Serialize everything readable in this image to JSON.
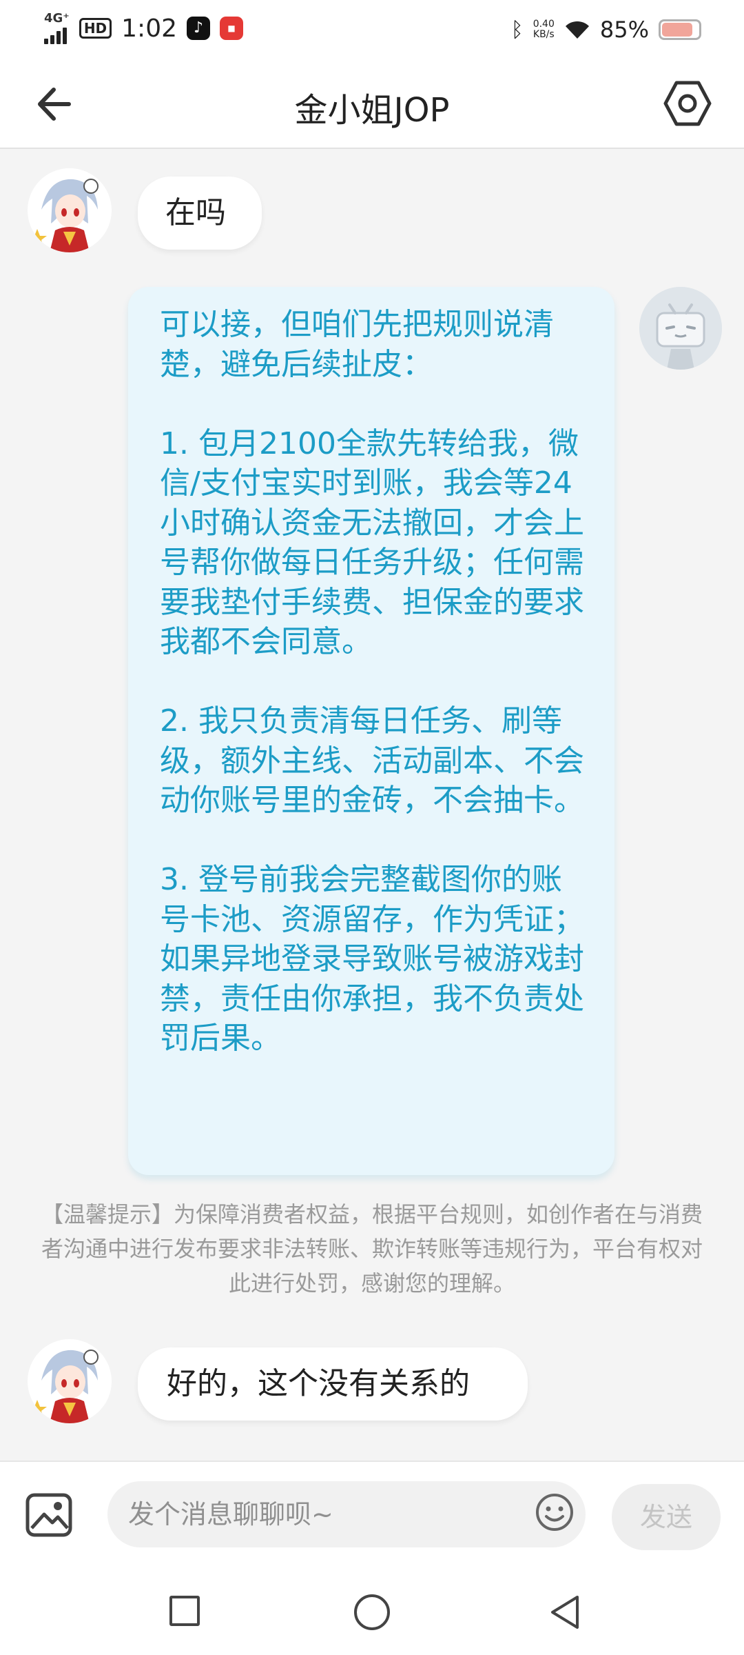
{
  "status_bar": {
    "network": "4G⁺",
    "time": "1:02",
    "hd": "HD",
    "net_speed_value": "0.40",
    "net_speed_unit": "KB/s",
    "battery_pct": "85%",
    "battery_level": 0.85,
    "battery_color": "#f1a59a"
  },
  "header": {
    "title": "金小姐JOP",
    "back_icon": "arrow-left-icon",
    "settings_icon": "hexagon-settings-icon"
  },
  "messages": {
    "m1": {
      "side": "left",
      "text": "在吗"
    },
    "m2": {
      "side": "right",
      "paragraphs": [
        "可以接，但咱们先把规则说清楚，避免后续扯皮：",
        "1. 包月2100全款先转给我，微信/支付宝实时到账，我会等24小时确认资金无法撤回，才会上号帮你做每日任务升级；任何需要我垫付手续费、担保金的要求我都不会同意。",
        "2. 我只负责清每日任务、刷等级，额外主线、活动副本、不会动你账号里的金砖，不会抽卡。",
        "3. 登号前我会完整截图你的账号卡池、资源留存，作为凭证；如果异地登录导致账号被游戏封禁，责任由你承担，我不负责处罚后果。"
      ]
    },
    "notice": "【温馨提示】为保障消费者权益，根据平台规则，如创作者在与消费者沟通中进行发布要求非法转账、欺诈转账等违规行为，平台有权对此进行处罚，感谢您的理解。",
    "m3": {
      "side": "left",
      "text": "好的，这个没有关系的"
    }
  },
  "input_bar": {
    "placeholder": "发个消息聊聊呗~",
    "send_label": "发送",
    "image_icon": "image-icon",
    "emoji_icon": "emoji-icon"
  },
  "colors": {
    "accent_text": "#1c9cc6",
    "bubble_right_bg": "#e8f6fc",
    "background": "#f4f4f4"
  }
}
